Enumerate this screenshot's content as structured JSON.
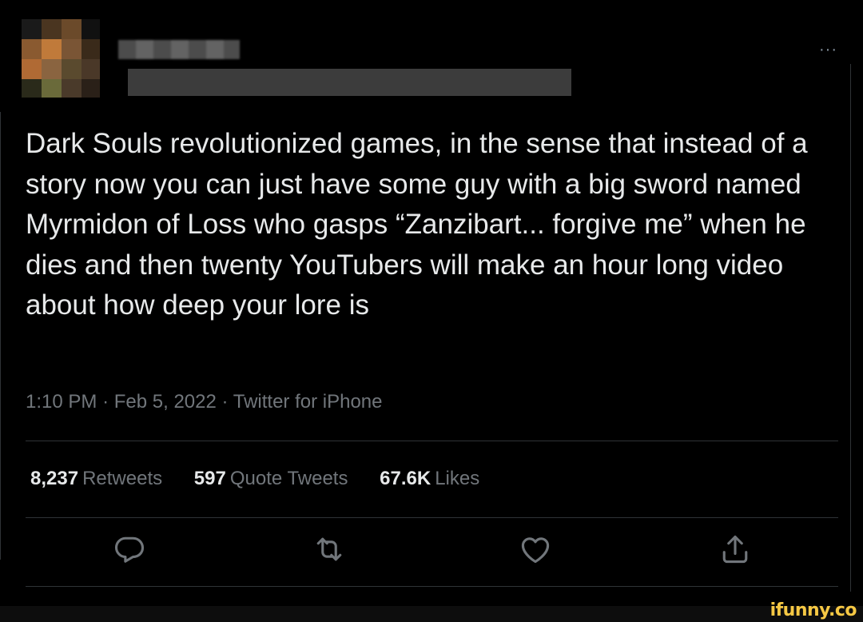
{
  "tweet": {
    "text": "Dark Souls revolutionized games, in the sense that instead of a story now you can just have some guy with a big sword named Myrmidon of Loss who gasps “Zanzibart... forgive me” when he dies and then twenty YouTubers will make an hour long video about how deep your lore is",
    "time": "1:10 PM",
    "separator": "·",
    "date": "Feb 5, 2022",
    "source": "Twitter for iPhone",
    "more_label": "···"
  },
  "stats": {
    "retweets": {
      "count": "8,237",
      "label": "Retweets"
    },
    "quotes": {
      "count": "597",
      "label": "Quote Tweets"
    },
    "likes": {
      "count": "67.6K",
      "label": "Likes"
    }
  },
  "actions": [
    {
      "icon": "reply-icon"
    },
    {
      "icon": "retweet-icon"
    },
    {
      "icon": "like-icon"
    },
    {
      "icon": "share-icon"
    }
  ],
  "watermark": "ifunny.co",
  "colors": {
    "background": "#000000",
    "text": "#e7e9ea",
    "secondary": "#71767b",
    "divider": "#2f3336",
    "watermark": "#f6c844"
  }
}
